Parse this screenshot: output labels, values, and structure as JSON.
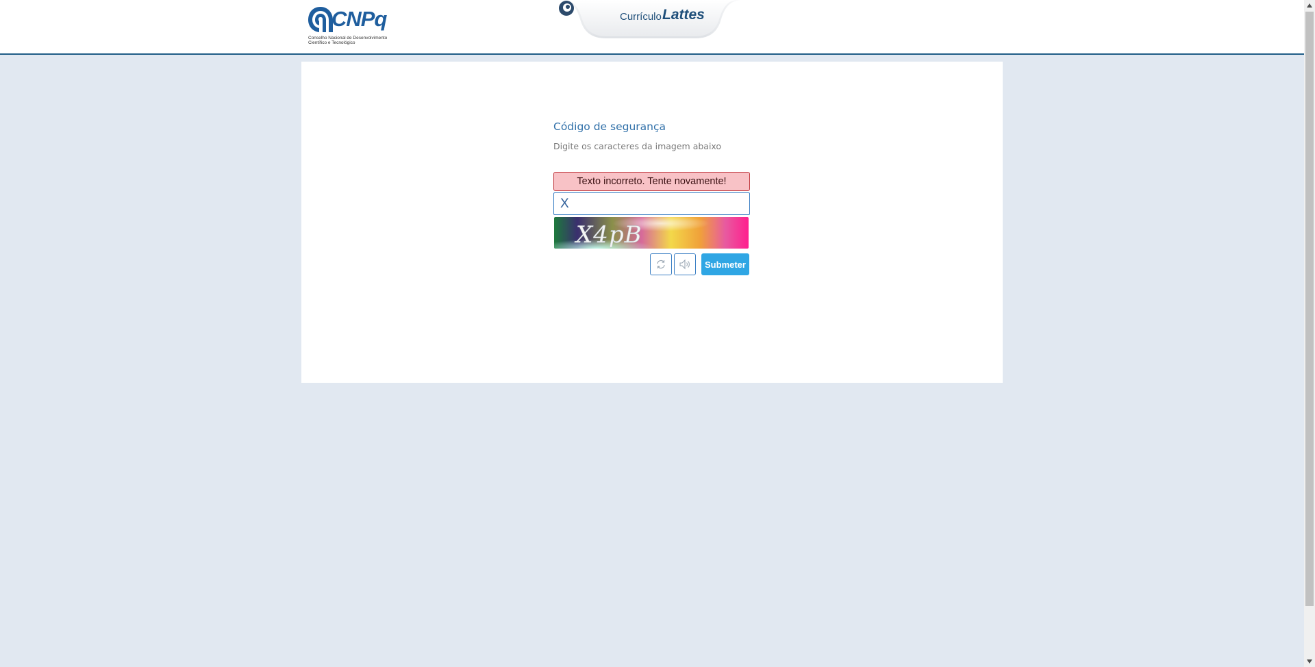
{
  "header": {
    "logo_word": "CNPq",
    "logo_subtitle_line1": "Conselho Nacional de Desenvolvimento",
    "logo_subtitle_line2": "Científico e Tecnológico",
    "system_prefix": "Currículo",
    "system_name": "Lattes"
  },
  "captcha": {
    "title": "Código de segurança",
    "subtitle": "Digite os caracteres da imagem abaixo",
    "error_message": "Texto incorreto. Tente novamente!",
    "input_value": "X",
    "image_text": "X4pB",
    "refresh_icon": "refresh-icon",
    "audio_icon": "speaker-icon",
    "submit_label": "Submeter"
  },
  "colors": {
    "page_background": "#e1e8f1",
    "brand_blue": "#1f5e9e",
    "title_blue": "#2f6fa8",
    "error_background": "#f8c2c6",
    "error_border": "#c0393f",
    "submit_button": "#2fa6e4"
  }
}
